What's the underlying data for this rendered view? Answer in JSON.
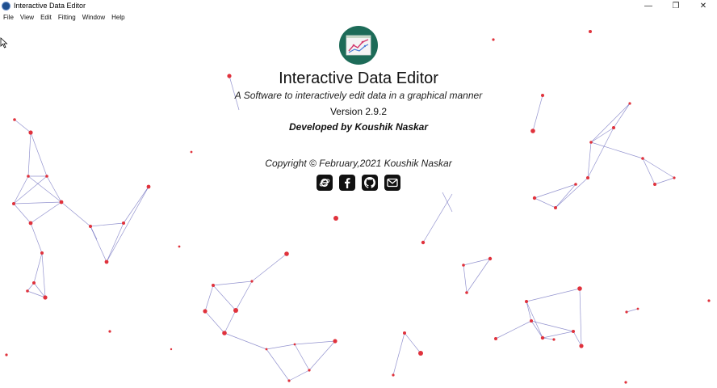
{
  "window": {
    "title": "Interactive Data Editor",
    "controls": [
      "—",
      "❐",
      "✕"
    ]
  },
  "menu": [
    "File",
    "View",
    "Edit",
    "Fitting",
    "Window",
    "Help"
  ],
  "about": {
    "app_name": "Interactive Data Editor",
    "tagline": "A Software to interactively edit data in a graphical manner",
    "version": "Version 2.9.2",
    "developer": "Developed by Koushik Naskar",
    "copyright": "Copyright © February,2021 Koushik Naskar",
    "social_icons": [
      "website-icon",
      "facebook-icon",
      "github-icon",
      "email-icon"
    ]
  },
  "colors": {
    "node": "#e0323c",
    "edge": "#3a3aa8",
    "logo_bg": "#1d6b58"
  }
}
